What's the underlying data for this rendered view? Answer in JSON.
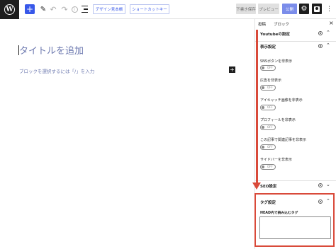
{
  "toolbar": {
    "add_label": "+",
    "design_label": "デザイン見本帳",
    "shortcut_label": "ショートカットキー",
    "draft_label": "下書き保存",
    "preview_label": "プレビュー",
    "publish_label": "公開",
    "more_label": "⋮"
  },
  "editor": {
    "title_placeholder": "タイトルを追加",
    "block_hint": "ブロックを選択するには「/」を入力",
    "block_add_label": "+"
  },
  "sidebar": {
    "tabs": [
      "投稿",
      "ブロック"
    ],
    "close_label": "×",
    "youtube_panel": "Youtubeの設定",
    "display_panel": "表示設定",
    "display_settings": [
      {
        "label": "SNSボタンを非表示",
        "toggle": "OFF"
      },
      {
        "label": "広告を非表示",
        "toggle": "OFF"
      },
      {
        "label": "アイキャッチ画像を非表示",
        "toggle": "OFF"
      },
      {
        "label": "プロフィールを非表示",
        "toggle": "OFF"
      },
      {
        "label": "この記事で関連記事を非表示",
        "toggle": "OFF"
      },
      {
        "label": "サイドバーを非表示",
        "toggle": "OFF"
      }
    ],
    "seo_panel": "SEO設定",
    "tag_panel": "タグ設定",
    "tag_field_label": "HEAD内で読み込むタグ",
    "tag_field_value": ""
  },
  "colors": {
    "accent": "#3858e9",
    "highlight": "#d94a3a",
    "dark": "#1e1e1e"
  }
}
